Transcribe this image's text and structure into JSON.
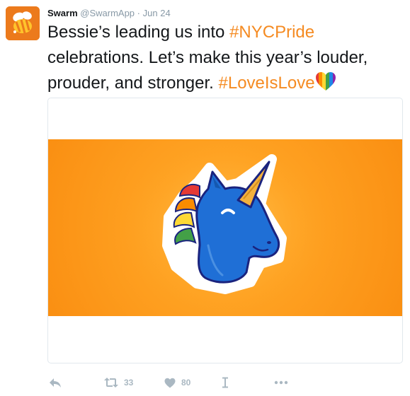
{
  "colors": {
    "accent_hashtag": "#f58b22",
    "brand_avatar": "#ec7a1c",
    "media_orange": "#fa8f12",
    "unicorn_blue": "#1f6fd6",
    "horn_gold": "#f3b13e",
    "muted": "#aab8c2",
    "meta_gray": "#8899a6"
  },
  "tweet": {
    "author_name": "Swarm",
    "handle": "@SwarmApp",
    "separator": "·",
    "timestamp": "Jun 24",
    "text_part1": "Bessie’s leading us into ",
    "hashtag1": "#NYCPride",
    "text_part2": " celebrations. Let’s make this year’s louder, prouder, and stronger. ",
    "hashtag2": "#LoveIsLove",
    "emoji": "rainbow-heart-emoji"
  },
  "media": {
    "image": "rainbow-unicorn-sticker"
  },
  "actions": {
    "reply_icon": "reply-icon",
    "retweet_icon": "retweet-icon",
    "retweet_count": "33",
    "like_icon": "heart-icon",
    "like_count": "80",
    "dm_icon": "direct-message-icon",
    "more_icon": "more-icon"
  }
}
